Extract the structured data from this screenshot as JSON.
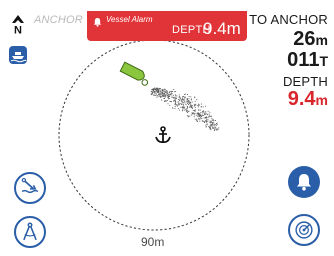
{
  "header": {
    "title": "ANCHOR W",
    "north_icon": "north-arrow-icon",
    "boat_badge_icon": "boat-icon"
  },
  "alarm": {
    "label": "Vessel Alarm",
    "depth_label": "DEPTH",
    "depth_value": "9.4m",
    "color": "#e13438",
    "icon": "bell-icon"
  },
  "readout": {
    "to_anchor_label": "TO ANCHOR",
    "distance_value": "26",
    "distance_unit": "m",
    "bearing_value": "011",
    "bearing_unit": "T",
    "depth_label": "DEPTH",
    "depth_value": "9.4",
    "depth_unit": "m",
    "depth_color": "#d9262b"
  },
  "radar": {
    "range_label": "90m",
    "center_icon": "anchor-icon",
    "vessel_color": "#8cc63f",
    "track_color": "#555555"
  },
  "buttons": {
    "anchor_drop_icon": "anchor-drop-icon",
    "compass_icon": "compass-icon",
    "alarm_icon": "bell-icon",
    "radar_icon": "radar-icon",
    "accent": "#2a5ea8"
  }
}
